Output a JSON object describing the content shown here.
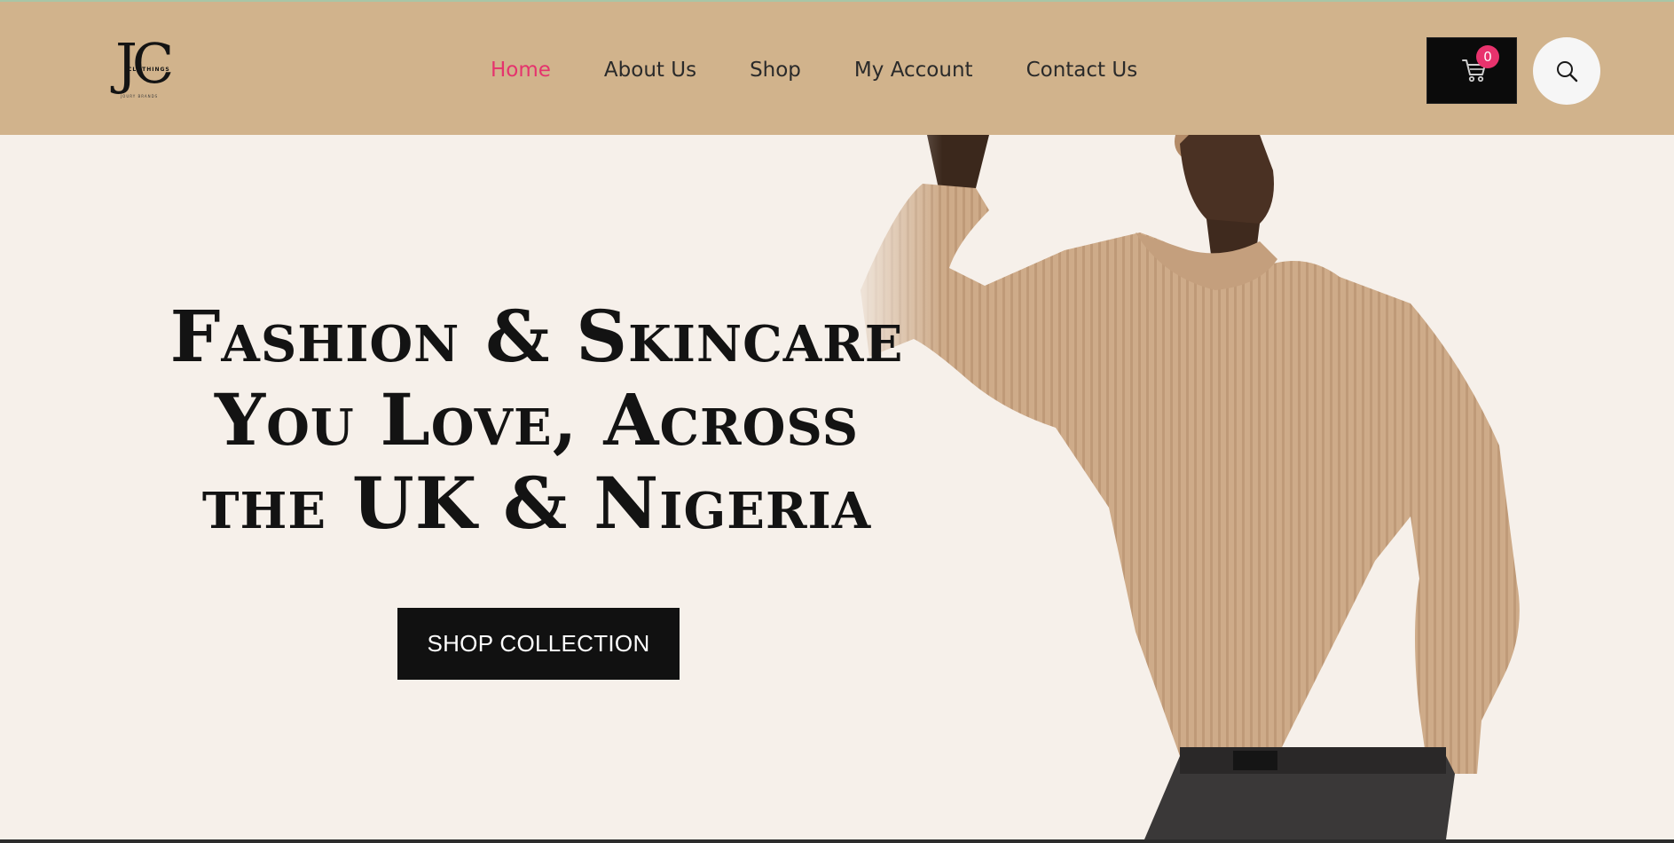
{
  "brand": {
    "logo_letters": "JC",
    "logo_subtitle": "CLOTHINGS",
    "logo_tagline": "JOURY BRANDS"
  },
  "nav": {
    "items": [
      {
        "label": "Home",
        "active": true
      },
      {
        "label": "About Us",
        "active": false
      },
      {
        "label": "Shop",
        "active": false
      },
      {
        "label": "My Account",
        "active": false
      },
      {
        "label": "Contact Us",
        "active": false
      }
    ]
  },
  "header_actions": {
    "cart_icon": "cart-icon",
    "cart_count": "0",
    "search_icon": "search-icon"
  },
  "hero": {
    "headline_lines": [
      "Fashion & Skincare",
      "You Love, Across",
      "the UK & Nigeria"
    ],
    "cta_label": "SHOP COLLECTION"
  },
  "colors": {
    "header_bg": "#d1b38c",
    "hero_bg": "#f6f0ea",
    "accent_pink": "#e5336d",
    "button_dark": "#111111"
  }
}
